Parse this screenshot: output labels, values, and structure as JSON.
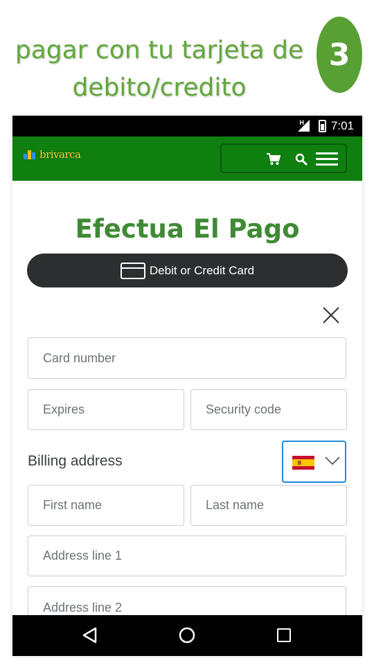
{
  "slide": {
    "title_line1": "pagar con tu tarjeta de",
    "title_line2": "debito/credito",
    "step_number": "3",
    "accent_color": "#63a83c"
  },
  "status_bar": {
    "network": "H",
    "time": "7:01"
  },
  "app_bar": {
    "brand": "brivarca",
    "background_color": "#0f7f10",
    "icons": [
      "cart-icon",
      "search-icon",
      "menu-icon"
    ]
  },
  "page": {
    "heading": "Efectua El Pago",
    "pay_button_label": "Debit or Credit Card",
    "close_icon": "close-icon"
  },
  "form": {
    "card_number_placeholder": "Card number",
    "expires_placeholder": "Expires",
    "security_code_placeholder": "Security code",
    "billing_label": "Billing address",
    "country_flag": "spain-flag",
    "first_name_placeholder": "First name",
    "last_name_placeholder": "Last name",
    "address1_placeholder": "Address line 1",
    "address2_placeholder": "Address line 2",
    "focus_color": "#1f8ad8"
  },
  "nav_bar": {
    "icons": [
      "back-icon",
      "home-icon",
      "recents-icon"
    ]
  }
}
